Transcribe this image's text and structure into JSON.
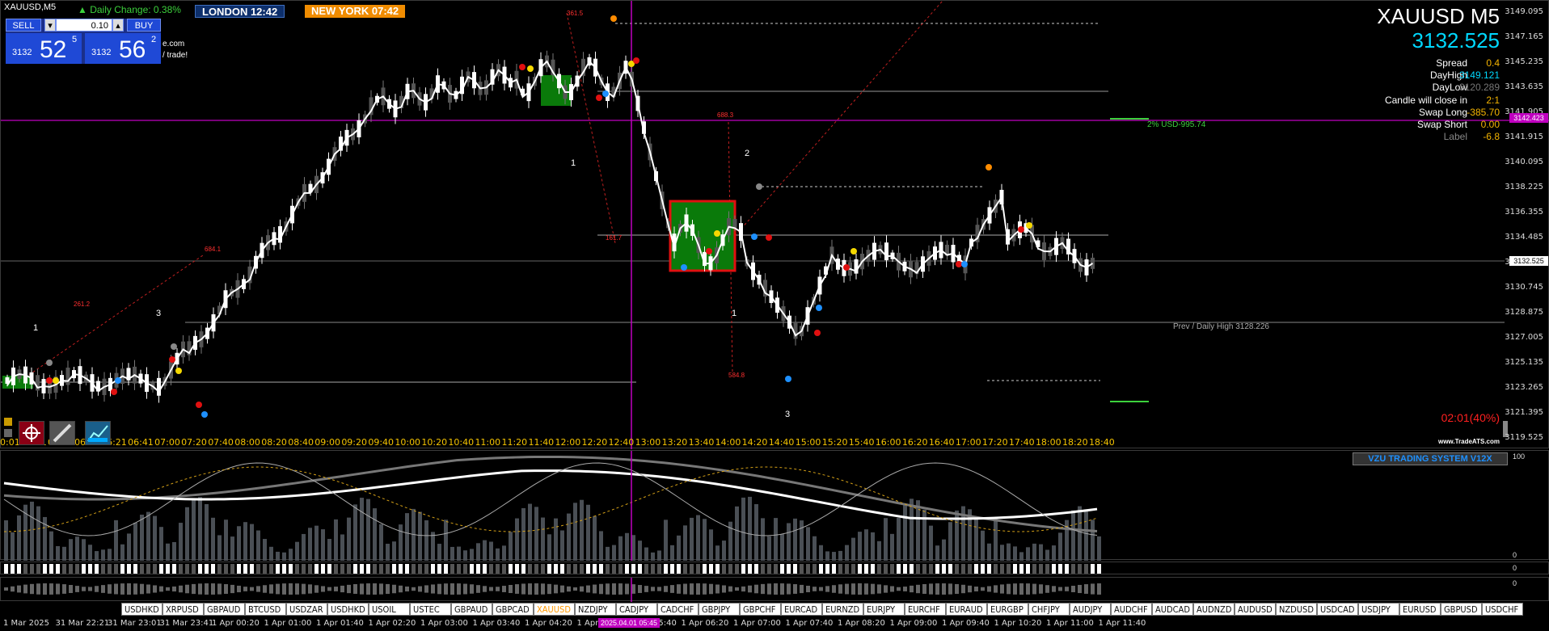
{
  "window": {
    "symbol_title": "XAUUSD,M5",
    "daily_change": "▲ Daily Change: 0.38%",
    "session_london": "LONDON  12:42",
    "session_newyork": "NEW YORK  07:42"
  },
  "trade_panel": {
    "sell_label": "SELL",
    "buy_label": "BUY",
    "lot_value": "0.10",
    "sell_prefix": "3132",
    "sell_big": "52",
    "sell_sup": "5",
    "buy_prefix": "3132",
    "buy_big": "56",
    "buy_sup": "2",
    "note1": "e.com",
    "note2": "/ trade!"
  },
  "info": {
    "symbol_tf": "XAUUSD M5",
    "price": "3132.525",
    "rows": [
      {
        "label": "Spread",
        "value": "0.4"
      },
      {
        "label": "DayHigh",
        "value": "3149.121"
      },
      {
        "label": "DayLow",
        "value": "3120.289"
      },
      {
        "label": "Candle will close in",
        "value": "2:1"
      },
      {
        "label": "Swap Long",
        "value": "-385.70"
      },
      {
        "label": "Swap Short",
        "value": "0.00"
      },
      {
        "label": "Label",
        "value": "-6.8"
      }
    ],
    "timer": "02:01(40%)",
    "watermark": "www.TradeATS.com",
    "risk_label": "2% USD-995.74",
    "prev_high": "Prev / Daily High 3128.226",
    "magenta_tag": "3142.423",
    "current_tag": "3132.525"
  },
  "price_axis": [
    "3149.095",
    "3147.165",
    "3145.235",
    "3143.635",
    "3141.905",
    "3141.915",
    "3140.095",
    "3138.225",
    "3136.355",
    "3134.485",
    "3132.525",
    "3130.745",
    "3128.875",
    "3127.005",
    "3125.135",
    "3123.265",
    "3121.395",
    "3119.525"
  ],
  "time_axis": [
    "00:01",
    "05:21",
    "05:41",
    "06:01",
    "06:21",
    "06:41",
    "07:00",
    "07:20",
    "07:40",
    "08:00",
    "08:20",
    "08:40",
    "09:00",
    "09:20",
    "09:40",
    "10:00",
    "10:20",
    "10:40",
    "11:00",
    "11:20",
    "11:40",
    "12:00",
    "12:20",
    "12:40",
    "13:00",
    "13:20",
    "13:40",
    "14:00",
    "14:20",
    "14:40",
    "15:00",
    "15:20",
    "15:40",
    "16:00",
    "16:20",
    "16:40",
    "17:00",
    "17:20",
    "17:40",
    "18:00",
    "18:20",
    "18:40"
  ],
  "wave_labels": [
    {
      "t": "1"
    },
    {
      "t": "3"
    },
    {
      "t": "1"
    },
    {
      "t": "2"
    },
    {
      "t": "1"
    },
    {
      "t": "3"
    }
  ],
  "fib_labels": [
    "361.5",
    "261.2",
    "684.1",
    "161.7",
    "584.8",
    "688.3"
  ],
  "indicator": {
    "title": "VZU TRADING SYSTEM V12X",
    "axis_top": "100",
    "axis_bottom": "0",
    "strip1_axis": "0",
    "strip2_axis": "0"
  },
  "tabs": [
    "USDHKD",
    "XRPUSD",
    "GBPAUD",
    "BTCUSD",
    "USDZAR",
    "USDHKD",
    "USOIL",
    "USTEC",
    "GBPAUD",
    "GBPCAD",
    "XAUUSD",
    "NZDJPY",
    "CADJPY",
    "CADCHF",
    "GBPJPY",
    "GBPCHF",
    "EURCAD",
    "EURNZD",
    "EURJPY",
    "EURCHF",
    "EURAUD",
    "EURGBP",
    "CHFJPY",
    "AUDJPY",
    "AUDCHF",
    "AUDCAD",
    "AUDNZD",
    "AUDUSD",
    "NZDUSD",
    "USDCAD",
    "USDJPY",
    "EURUSD",
    "GBPUSD",
    "USDCHF"
  ],
  "active_tab": "XAUUSD",
  "bottom_times": [
    "1 Mar 2025",
    "31 Mar 22:21",
    "31 Mar 23:01",
    "31 Mar 23:41",
    "1 Apr 00:20",
    "1 Apr 01:00",
    "1 Apr 01:40",
    "1 Apr 02:20",
    "1 Apr 03:00",
    "1 Apr 03:40",
    "1 Apr 04:20",
    "1 Apr 05:00",
    "1 Apr 05:40",
    "1 Apr 06:20",
    "1 Apr 07:00",
    "1 Apr 07:40",
    "1 Apr 08:20",
    "1 Apr 09:00",
    "1 Apr 09:40",
    "1 Apr 10:20",
    "1 Apr 11:00",
    "1 Apr 11:40"
  ],
  "cursor_time": "2025.04.01 05:45",
  "colors": {
    "accent": "#1e90ff",
    "bull": "#ffffff",
    "bear": "#555555",
    "magenta": "#c000c0",
    "green_zone": "#0a7a0a",
    "price_cyan": "#00d8ff",
    "info_value": "#f5b400"
  }
}
